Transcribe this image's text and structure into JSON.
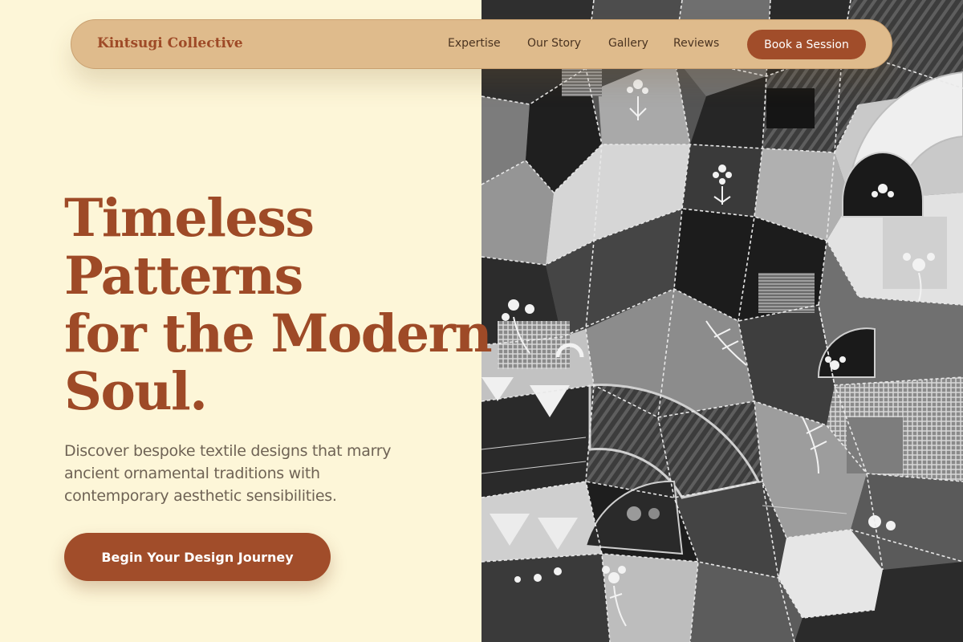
{
  "nav": {
    "brand": "Kintsugi Collective",
    "links": [
      "Expertise",
      "Our Story",
      "Gallery",
      "Reviews"
    ],
    "cta_label": "Book a Session"
  },
  "hero": {
    "title_lines": [
      "Timeless",
      "Patterns",
      "for the Modern",
      "Soul."
    ],
    "subtitle_lines": [
      "Discover bespoke textile designs that marry",
      "ancient ornamental traditions with",
      "contemporary aesthetic sensibilities."
    ],
    "cta_label": "Begin Your Design Journey"
  },
  "image": {
    "subject": "black and white photograph of a crazy quilt with embroidered floral patches, fan motifs and feather-stitched seams"
  },
  "colors": {
    "background": "#fdf6d8",
    "nav_background": "#dfbb8c",
    "accent": "#a14d2a",
    "title_text": "#9e4a27",
    "body_text": "#6f6355"
  }
}
